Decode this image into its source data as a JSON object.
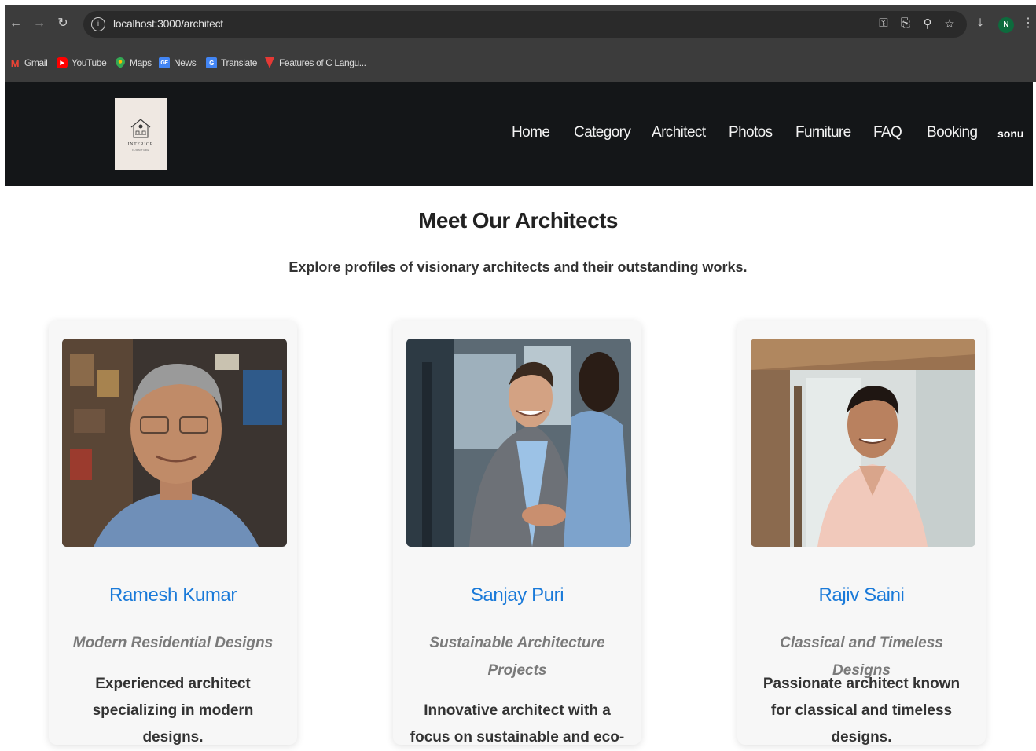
{
  "browser": {
    "url": "localhost:3000/architect",
    "profile_initial": "N",
    "bookmarks": [
      {
        "label": "Gmail",
        "icon": "gmail-icon"
      },
      {
        "label": "YouTube",
        "icon": "youtube-icon"
      },
      {
        "label": "Maps",
        "icon": "maps-icon"
      },
      {
        "label": "News",
        "icon": "news-icon"
      },
      {
        "label": "Translate",
        "icon": "translate-icon"
      },
      {
        "label": "Features of C Langu...",
        "icon": "bookmark-icon"
      }
    ]
  },
  "header": {
    "logo_text": "INTERIOR",
    "logo_subtext": "FURNITURE",
    "nav": [
      "Home",
      "Category",
      "Architect",
      "Photos",
      "Furniture",
      "FAQ",
      "Booking"
    ],
    "user": "sonu"
  },
  "main": {
    "title": "Meet Our Architects",
    "subtitle": "Explore profiles of visionary architects and their outstanding works.",
    "cards": [
      {
        "name": "Ramesh Kumar",
        "specialty": "Modern Residential Designs",
        "description": "Experienced architect specializing in modern designs."
      },
      {
        "name": "Sanjay Puri",
        "specialty": "Sustainable Architecture Projects",
        "description": "Innovative architect with a focus on sustainable and eco-"
      },
      {
        "name": "Rajiv Saini",
        "specialty": "Classical and Timeless Designs",
        "description": "Passionate architect known for classical and timeless designs."
      }
    ]
  },
  "colors": {
    "header_bg": "#141618",
    "name_blue": "#1a7ad9",
    "chrome_bg": "#3c3c3c"
  }
}
